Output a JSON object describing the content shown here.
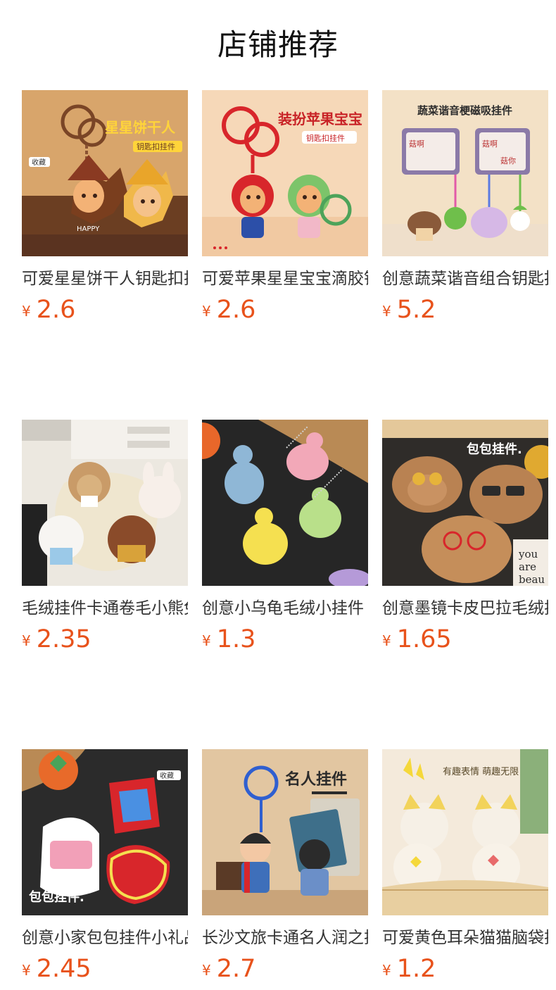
{
  "header": {
    "title": "店铺推荐"
  },
  "currency_symbol": "¥",
  "products": [
    {
      "name": "可爱星星饼干人钥匙扣挂件",
      "price": "2.6",
      "image_text": [
        "星星饼干人",
        "钥匙扣挂件",
        "收藏",
        "HAPPY"
      ],
      "bg": "#d9a56c"
    },
    {
      "name": "可爱苹果星星宝宝滴胶钥匙扣",
      "price": "2.6",
      "image_text": [
        "装扮苹果宝宝",
        "钥匙扣挂件"
      ],
      "bg": "#f6d7b6"
    },
    {
      "name": "创意蔬菜谐音组合钥匙扣",
      "price": "5.2",
      "image_text": [
        "蔬菜谐音梗磁吸挂件",
        "菇啊",
        "菇啊",
        "菇你"
      ],
      "bg": "#f3e1c5"
    },
    {
      "name": "毛绒挂件卡通卷毛小熊兔子",
      "price": "2.35",
      "image_text": [],
      "bg": "#e8e3d9"
    },
    {
      "name": "创意小乌龟毛绒小挂件",
      "price": "1.3",
      "image_text": [],
      "bg": "#2a2a2a"
    },
    {
      "name": "创意墨镜卡皮巴拉毛绒挂件",
      "price": "1.65",
      "image_text": [
        "包包挂件.",
        "you",
        "are",
        "beau"
      ],
      "bg": "#2f2c29"
    },
    {
      "name": "创意小家包包挂件小礼品",
      "price": "2.45",
      "image_text": [
        "收藏",
        "包包挂件."
      ],
      "bg": "#2b2b2b"
    },
    {
      "name": "长沙文旅卡通名人润之挂件",
      "price": "2.7",
      "image_text": [
        "名人挂件"
      ],
      "bg": "#e3c7a2"
    },
    {
      "name": "可爱黄色耳朵猫猫脑袋挂件",
      "price": "1.2",
      "image_text": [
        "有趣表情 萌趣无限"
      ],
      "bg": "#f4ead9"
    }
  ]
}
